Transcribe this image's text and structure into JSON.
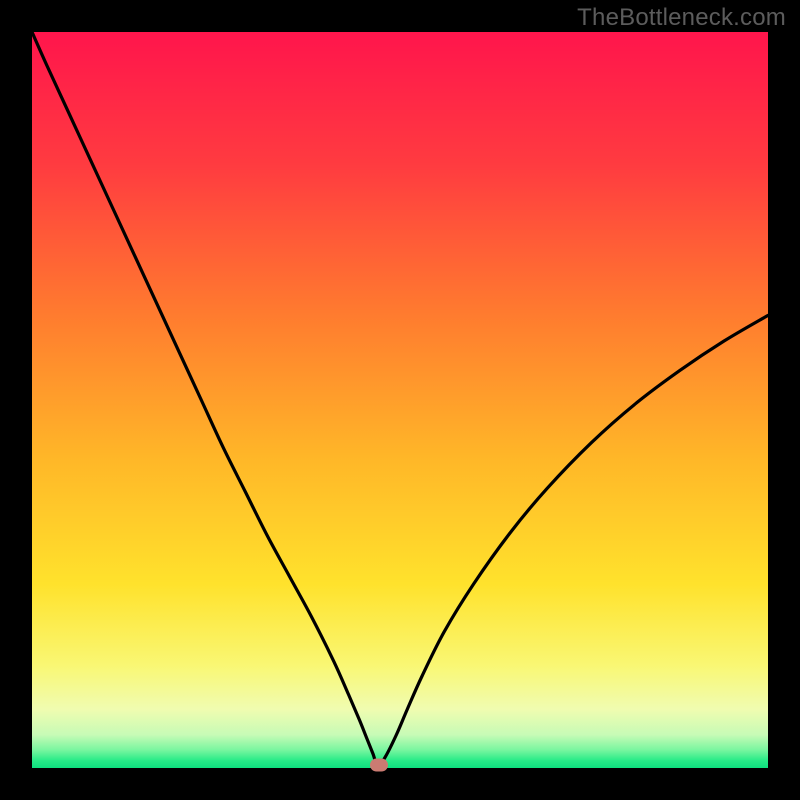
{
  "watermark": "TheBottleneck.com",
  "chart_data": {
    "type": "line",
    "title": "",
    "xlabel": "",
    "ylabel": "",
    "xlim": [
      0,
      100
    ],
    "ylim": [
      0,
      100
    ],
    "gradient_stops": [
      {
        "offset": 0.0,
        "color": "#ff154c"
      },
      {
        "offset": 0.18,
        "color": "#ff3b40"
      },
      {
        "offset": 0.38,
        "color": "#ff7a2f"
      },
      {
        "offset": 0.58,
        "color": "#ffb728"
      },
      {
        "offset": 0.75,
        "color": "#ffe22c"
      },
      {
        "offset": 0.86,
        "color": "#f9f773"
      },
      {
        "offset": 0.92,
        "color": "#f0fcb0"
      },
      {
        "offset": 0.955,
        "color": "#c7fbb6"
      },
      {
        "offset": 0.975,
        "color": "#7bf6a0"
      },
      {
        "offset": 0.99,
        "color": "#26eb87"
      },
      {
        "offset": 1.0,
        "color": "#0ee07f"
      }
    ],
    "series": [
      {
        "name": "bottleneck-curve",
        "color": "#000000",
        "x": [
          0,
          2,
          5,
          8,
          11,
          14,
          17,
          20,
          23,
          26,
          29,
          32,
          35,
          38,
          41,
          43,
          44.5,
          45.5,
          46.3,
          47,
          48,
          49.5,
          51,
          53,
          56,
          60,
          65,
          70,
          76,
          82,
          88,
          94,
          100
        ],
        "y": [
          100,
          95.5,
          89,
          82.5,
          76,
          69.5,
          63,
          56.5,
          50,
          43.5,
          37.5,
          31.5,
          26,
          20.5,
          14.5,
          10,
          6.5,
          4,
          2,
          0.3,
          1.5,
          4.5,
          8,
          12.5,
          18.5,
          25,
          32,
          38,
          44.2,
          49.5,
          54,
          58,
          61.5
        ]
      }
    ],
    "marker": {
      "x": 47.2,
      "y": 0.4,
      "color": "#cb7b72"
    }
  }
}
